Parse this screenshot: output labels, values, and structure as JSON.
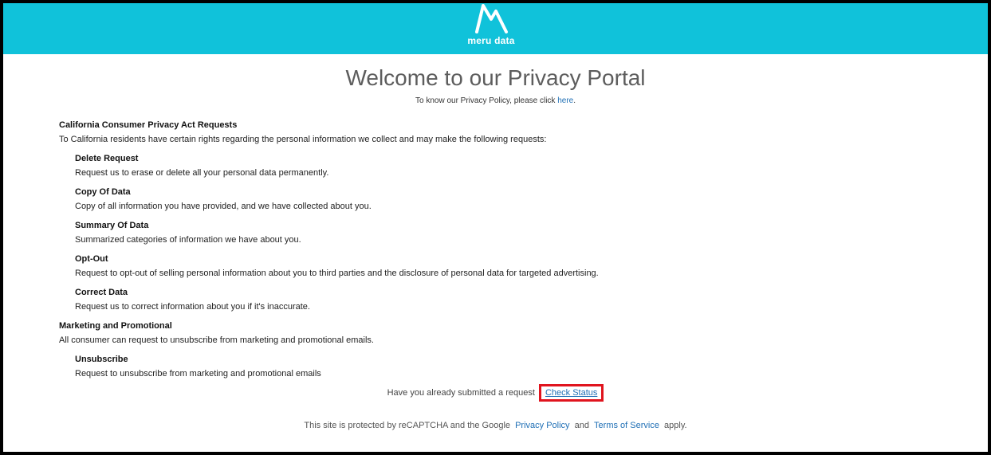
{
  "header": {
    "logo_text": "meru data",
    "bg_color": "#10c2da"
  },
  "intro": {
    "title": "Welcome to our Privacy Portal",
    "subtitle_prefix": "To know our Privacy Policy, please click",
    "subtitle_link": "here",
    "subtitle_suffix": "."
  },
  "sections": {
    "ccpa": {
      "title": "California Consumer Privacy Act Requests",
      "desc": "To California residents have certain rights regarding the personal information we collect and may make the following requests:",
      "items": [
        {
          "title": "Delete Request",
          "desc": "Request us to erase or delete all your personal data permanently."
        },
        {
          "title": "Copy Of Data",
          "desc": "Copy of all information you have provided, and we have collected about you."
        },
        {
          "title": "Summary Of Data",
          "desc": "Summarized categories of information we have about you."
        },
        {
          "title": "Opt-Out",
          "desc": "Request to opt-out of selling personal information about you to third parties and the disclosure of personal data for targeted advertising."
        },
        {
          "title": "Correct Data",
          "desc": "Request us to correct information about you if it's inaccurate."
        }
      ]
    },
    "marketing": {
      "title": "Marketing and Promotional",
      "desc": "All consumer can request to unsubscribe from marketing and promotional emails.",
      "items": [
        {
          "title": "Unsubscribe",
          "desc": "Request to unsubscribe from marketing and promotional emails"
        }
      ]
    }
  },
  "status": {
    "prompt": "Have you already submitted a request",
    "link": "Check Status",
    "highlight_color": "#e0141e"
  },
  "footer": {
    "prefix": "This site is protected by reCAPTCHA and the Google",
    "privacy_link": "Privacy Policy",
    "and": "and",
    "terms_link": "Terms of Service",
    "suffix": "apply."
  },
  "colors": {
    "link": "#1f6fb5",
    "title": "#5d5d5d"
  }
}
